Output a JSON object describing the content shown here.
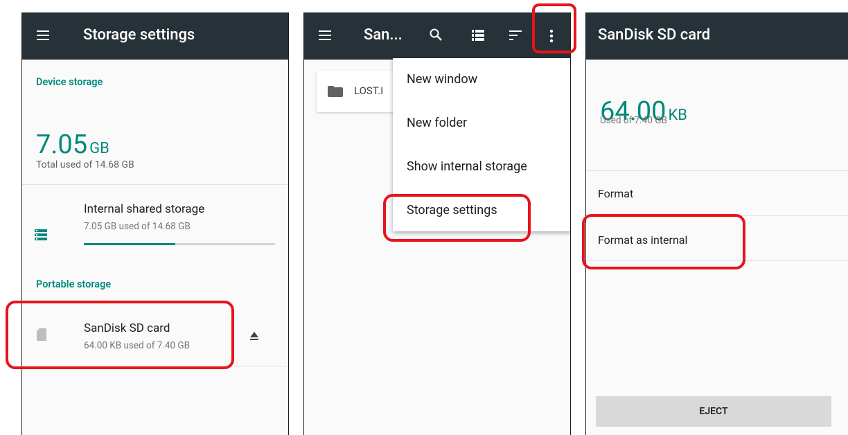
{
  "panel1": {
    "title": "Storage settings",
    "device_storage_header": "Device storage",
    "used_value": "7.05",
    "used_unit": "GB",
    "total_used_text": "Total used of 14.68 GB",
    "internal": {
      "title": "Internal shared storage",
      "subtitle": "7.05 GB used of 14.68 GB",
      "usage_fraction": 0.48
    },
    "portable_storage_header": "Portable storage",
    "sd_card": {
      "title": "SanDisk SD card",
      "subtitle": "64.00 KB used of 7.40 GB"
    }
  },
  "panel2": {
    "title": "San...",
    "file_name": "LOST.I",
    "menu": {
      "items": [
        "New window",
        "New folder",
        "Show internal storage",
        "Storage settings"
      ]
    }
  },
  "panel3": {
    "title": "SanDisk SD card",
    "used_value": "64.00",
    "used_unit": "KB",
    "used_of_text": "Used of 7.40 GB",
    "format_label": "Format",
    "format_internal_label": "Format as internal",
    "eject_label": "EJECT"
  },
  "colors": {
    "appbar": "#263238",
    "accent": "#00897b",
    "highlight": "#e8131b"
  }
}
